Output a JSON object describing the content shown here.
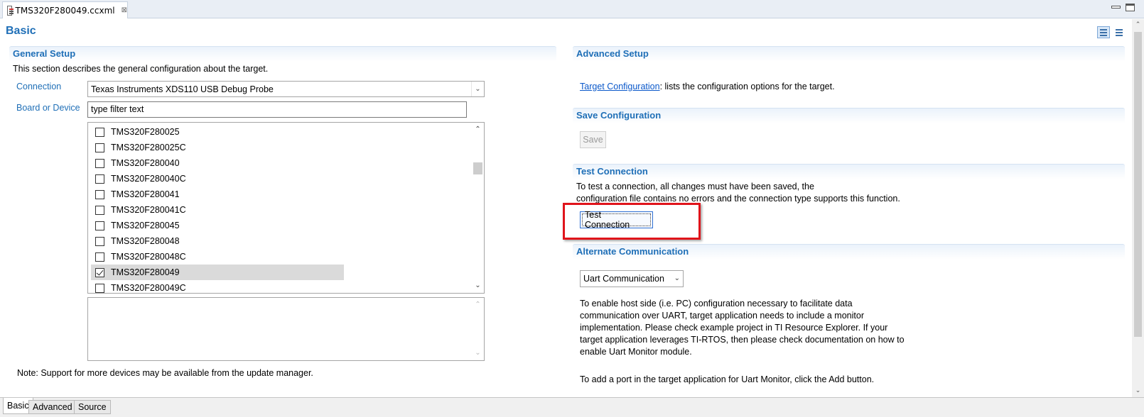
{
  "editor_tab": {
    "title": "TMS320F280049.ccxml",
    "close_glyph": "⊠"
  },
  "page": {
    "title": "Basic"
  },
  "general_setup": {
    "header": "General Setup",
    "description": "This section describes the general configuration about the target.",
    "connection_label": "Connection",
    "connection_value": "Texas Instruments XDS110 USB Debug Probe",
    "board_label": "Board or Device",
    "filter_text": "type filter text",
    "devices": [
      {
        "label": "TMS320F280025",
        "checked": false
      },
      {
        "label": "TMS320F280025C",
        "checked": false
      },
      {
        "label": "TMS320F280040",
        "checked": false
      },
      {
        "label": "TMS320F280040C",
        "checked": false
      },
      {
        "label": "TMS320F280041",
        "checked": false
      },
      {
        "label": "TMS320F280041C",
        "checked": false
      },
      {
        "label": "TMS320F280045",
        "checked": false
      },
      {
        "label": "TMS320F280048",
        "checked": false
      },
      {
        "label": "TMS320F280048C",
        "checked": false
      },
      {
        "label": "TMS320F280049",
        "checked": true
      },
      {
        "label": "TMS320F280049C",
        "checked": false
      }
    ],
    "note": "Note: Support for more devices may be available from the update manager."
  },
  "advanced_setup": {
    "header": "Advanced Setup",
    "link_text": "Target Configuration",
    "link_suffix": ": lists the configuration options for the target."
  },
  "save_configuration": {
    "header": "Save Configuration",
    "button_label": "Save"
  },
  "test_connection": {
    "header": "Test Connection",
    "line1": "To test a connection, all changes must have been saved, the",
    "line2": "configuration file contains no errors and the connection type supports this function.",
    "button_label": "Test Connection"
  },
  "alternate_communication": {
    "header": "Alternate Communication",
    "select_value": "Uart Communication",
    "para1": [
      "To enable host side (i.e. PC) configuration necessary to facilitate data",
      "communication over UART, target application needs to include a monitor",
      "implementation. Please check example project in TI Resource Explorer. If your",
      "target application leverages TI-RTOS, then please check documentation on how to",
      "enable Uart Monitor module."
    ],
    "para2": "To add a port in the target application for Uart Monitor, click the Add button."
  },
  "bottom_tabs": [
    "Basic",
    "Advanced",
    "Source"
  ],
  "colors": {
    "accent": "#1f6fb7",
    "highlight": "#e0141b",
    "selection": "#dadada"
  }
}
